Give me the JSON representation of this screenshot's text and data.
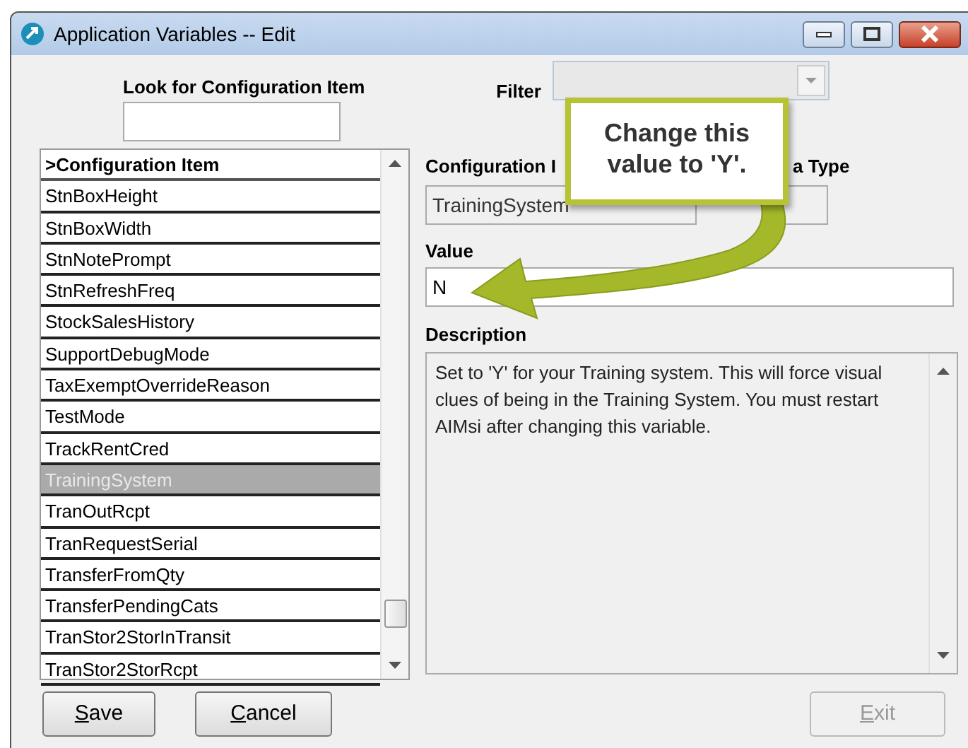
{
  "window": {
    "title": "Application Variables -- Edit"
  },
  "search": {
    "label": "Look for Configuration Item"
  },
  "filter": {
    "label": "Filter",
    "disabled": true
  },
  "list": {
    "header": ">Configuration Item",
    "items": [
      {
        "label": "StnBoxHeight",
        "selected": false
      },
      {
        "label": "StnBoxWidth",
        "selected": false
      },
      {
        "label": "StnNotePrompt",
        "selected": false
      },
      {
        "label": "StnRefreshFreq",
        "selected": false
      },
      {
        "label": "StockSalesHistory",
        "selected": false
      },
      {
        "label": "SupportDebugMode",
        "selected": false
      },
      {
        "label": "TaxExemptOverrideReason",
        "selected": false
      },
      {
        "label": "TestMode",
        "selected": false
      },
      {
        "label": "TrackRentCred",
        "selected": false
      },
      {
        "label": "TrainingSystem",
        "selected": true
      },
      {
        "label": "TranOutRcpt",
        "selected": false
      },
      {
        "label": "TranRequestSerial",
        "selected": false
      },
      {
        "label": "TransferFromQty",
        "selected": false
      },
      {
        "label": "TransferPendingCats",
        "selected": false
      },
      {
        "label": "TranStor2StorInTransit",
        "selected": false
      },
      {
        "label": "TranStor2StorRcpt",
        "selected": false
      }
    ]
  },
  "config_item": {
    "label": "Configuration I",
    "value": "TrainingSystem"
  },
  "data_type": {
    "label": "a Type"
  },
  "value": {
    "label": "Value",
    "value": "N"
  },
  "description": {
    "label": "Description",
    "text": "Set to 'Y' for your Training system. This will force visual clues of being in the Training System. You must restart AIMsi after changing this variable."
  },
  "buttons": [
    {
      "label": "Save",
      "disabled": false
    },
    {
      "label": "Cancel",
      "disabled": false
    },
    {
      "label": "Exit",
      "disabled": true
    }
  ],
  "callout": {
    "text": "Change this value to 'Y'."
  }
}
